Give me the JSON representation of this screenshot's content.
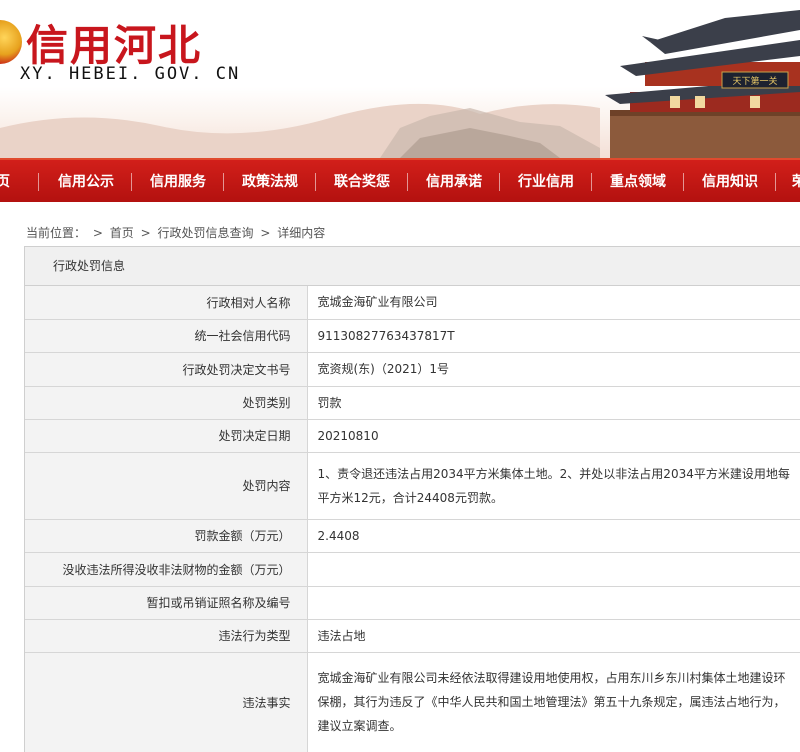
{
  "header": {
    "title": "信用河北",
    "domain": "XY. HEBEI. GOV. CN"
  },
  "nav": {
    "items": [
      "页",
      "信用公示",
      "信用服务",
      "政策法规",
      "联合奖惩",
      "信用承诺",
      "行业信用",
      "重点领域",
      "信用知识",
      "荣"
    ]
  },
  "breadcrumb": {
    "prefix": "当前位置：",
    "sep": ">",
    "home": "首页",
    "query": "行政处罚信息查询",
    "current": "详细内容"
  },
  "panel": {
    "title": "行政处罚信息"
  },
  "rows": [
    {
      "label": "行政相对人名称",
      "value": "宽城金海矿业有限公司"
    },
    {
      "label": "统一社会信用代码",
      "value": "91130827763437817T"
    },
    {
      "label": "行政处罚决定文书号",
      "value": "宽资规(东)（2021）1号"
    },
    {
      "label": "处罚类别",
      "value": "罚款"
    },
    {
      "label": "处罚决定日期",
      "value": "20210810"
    },
    {
      "label": "处罚内容",
      "value": "1、责令退还违法占用2034平方米集体土地。2、并处以非法占用2034平方米建设用地每平方米12元，合计24408元罚款。"
    },
    {
      "label": "罚款金额（万元）",
      "value": "2.4408"
    },
    {
      "label": "没收违法所得没收非法财物的金额（万元）",
      "value": ""
    },
    {
      "label": "暂扣或吊销证照名称及编号",
      "value": ""
    },
    {
      "label": "违法行为类型",
      "value": "违法占地"
    },
    {
      "label": "违法事实",
      "value": "宽城金海矿业有限公司未经依法取得建设用地使用权，占用东川乡东川村集体土地建设环保棚，其行为违反了《中华人民共和国土地管理法》第五十九条规定，属违法占地行为，建议立案调查。"
    },
    {
      "label": "",
      "value": ""
    }
  ]
}
